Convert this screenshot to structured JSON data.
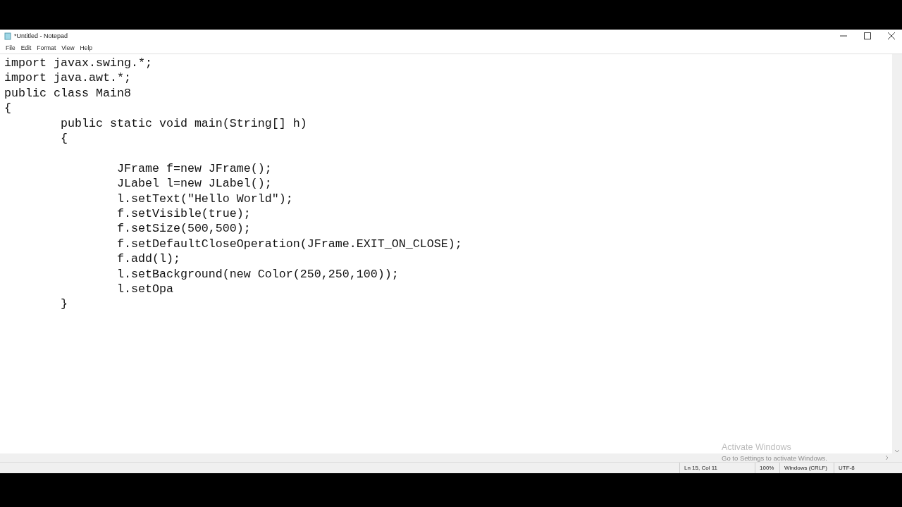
{
  "window": {
    "title": "*Untitled - Notepad"
  },
  "menu": [
    "File",
    "Edit",
    "Format",
    "View",
    "Help"
  ],
  "editor": {
    "lines": [
      {
        "kind": "code",
        "text": "import javax.swing.*;"
      },
      {
        "kind": "code",
        "text": "import java.awt.*;"
      },
      {
        "kind": "code",
        "text": "public class Main8"
      },
      {
        "kind": "code",
        "text": "{"
      },
      {
        "kind": "code",
        "text": "        public static void main(String[] h)"
      },
      {
        "kind": "code",
        "text": "        {"
      },
      {
        "kind": "blank"
      },
      {
        "kind": "code",
        "text": "                JFrame f=new JFrame();"
      },
      {
        "kind": "code",
        "text": "                JLabel l=new JLabel();"
      },
      {
        "kind": "code",
        "text": "                l.setText(\"Hello World\");"
      },
      {
        "kind": "code",
        "text": "                f.setVisible(true);"
      },
      {
        "kind": "code",
        "text": "                f.setSize(500,500);"
      },
      {
        "kind": "code",
        "text": "                f.setDefaultCloseOperation(JFrame.EXIT_ON_CLOSE);"
      },
      {
        "kind": "code",
        "text": "                f.add(l);"
      },
      {
        "kind": "code",
        "text": "                l.setBackground(new Color(250,250,100));"
      },
      {
        "kind": "code",
        "text": "                l.setOpa"
      },
      {
        "kind": "code",
        "text": "        }"
      }
    ]
  },
  "activation": {
    "title": "Activate Windows",
    "hint": "Go to Settings to activate Windows."
  },
  "status_bar": [
    "Ln 15, Col 11",
    "100%",
    "Windows (CRLF)",
    "UTF-8"
  ]
}
